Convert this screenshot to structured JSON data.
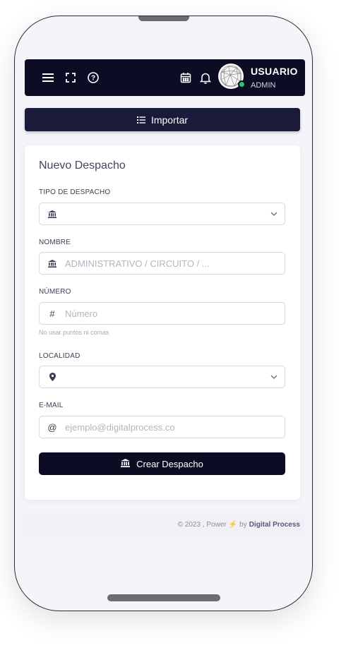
{
  "header": {
    "icons": [
      "menu-icon",
      "fullscreen-icon",
      "help-icon",
      "calendar-icon",
      "bell-icon"
    ],
    "user_name": "USUARIO",
    "user_role": "ADMIN",
    "status_color": "#28c76f"
  },
  "import_button": {
    "label": "Importar",
    "icon": "list-icon"
  },
  "form": {
    "title": "Nuevo Despacho",
    "fields": {
      "tipo": {
        "label": "TIPO DE DESPACHO",
        "value": "",
        "icon": "bank-icon"
      },
      "nombre": {
        "label": "NOMBRE",
        "placeholder": "ADMINISTRATIVO / CIRCUITO / ...",
        "icon": "bank-icon"
      },
      "numero": {
        "label": "NÚMERO",
        "placeholder": "Número",
        "hint": "No usar puntos ni comas",
        "icon": "hash-icon"
      },
      "localidad": {
        "label": "LOCALIDAD",
        "value": "",
        "icon": "map-pin-icon"
      },
      "email": {
        "label": "E-MAIL",
        "placeholder": "ejemplo@digitalprocess.co",
        "icon": "at-icon"
      }
    },
    "submit_label": "Crear Despacho"
  },
  "footer": {
    "prefix": "© 2023 , Power",
    "by": "by",
    "brand": "Digital Process"
  },
  "colors": {
    "dark": "#0c0c24",
    "accent": "#1a1a3b"
  }
}
